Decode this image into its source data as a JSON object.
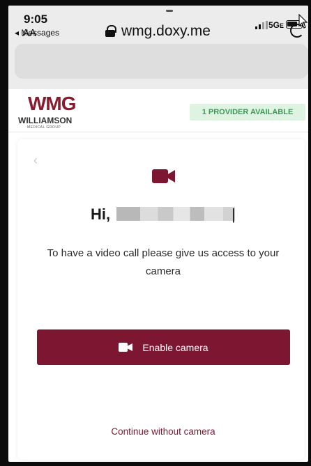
{
  "status_bar": {
    "time": "9:05",
    "back_app": "◂ Messages",
    "network": "5G",
    "network_suffix": "E"
  },
  "browser": {
    "text_size_label": "AA",
    "domain": "wmg.doxy.me"
  },
  "site": {
    "logo_text": "WMG",
    "logo_name": "WILLIAMSON",
    "logo_sub": "MEDICAL GROUP",
    "provider_badge": "1 PROVIDER AVAILABLE"
  },
  "card": {
    "back_glyph": "‹",
    "greeting": "Hi,",
    "message": "To have a video call please give us access to your camera",
    "enable_button": "Enable camera",
    "continue_link": "Continue without camera"
  },
  "colors": {
    "brand": "#7d1731",
    "badge_bg": "#dff3e3",
    "badge_text": "#3a9a55"
  }
}
